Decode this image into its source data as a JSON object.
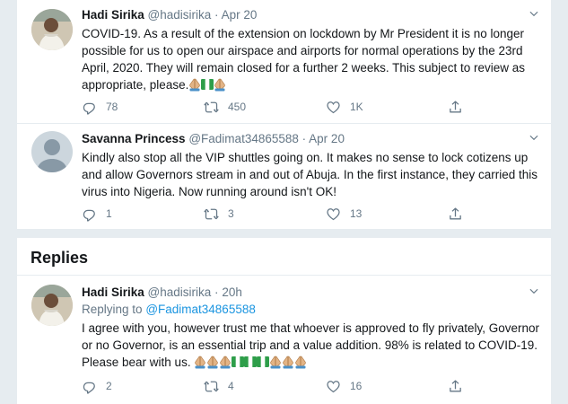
{
  "tweets": [
    {
      "name": "Hadi Sirika",
      "handle": "@hadisirika",
      "time": "Apr 20",
      "text": "COVID-19. As a result of the extension on lockdown by Mr President it is no longer possible for us to open our airspace and airports for normal operations by the 23rd April, 2020. They will remain closed for a further 2 weeks. This subject to review as appropriate, please.",
      "emoji": [
        "folded-hands",
        "nigeria-flag",
        "folded-hands"
      ],
      "replies": "78",
      "retweets": "450",
      "likes": "1K"
    },
    {
      "name": "Savanna Princess",
      "handle": "@Fadimat34865588",
      "time": "Apr 20",
      "text": "Kindly also stop all the VIP shuttles going on. It makes no sense to lock cotizens up and allow Governors stream in and out of Abuja. In the first instance, they carried this virus into Nigeria. Now running around isn't OK!",
      "replies": "1",
      "retweets": "3",
      "likes": "13"
    },
    {
      "name": "Hadi Sirika",
      "handle": "@hadisirika",
      "time": "20h",
      "replying_label": "Replying to",
      "replying_to": "@Fadimat34865588",
      "text": "I agree with you, however trust me that whoever is approved to fly privately, Governor or no Governor, is an essential trip and a value addition. 98% is related to COVID-19. Please bear with us.",
      "emoji": [
        "folded-hands",
        "folded-hands",
        "folded-hands",
        "nigeria-flag",
        "nigeria-flag",
        "nigeria-flag",
        "folded-hands",
        "folded-hands",
        "folded-hands"
      ],
      "replies": "2",
      "retweets": "4",
      "likes": "16"
    }
  ],
  "replies_heading": "Replies",
  "colors": {
    "text": "#14171a",
    "secondary": "#657786",
    "link": "#1b95e0",
    "border": "#e6ecf0",
    "flag_green": "#2e9e4a"
  }
}
